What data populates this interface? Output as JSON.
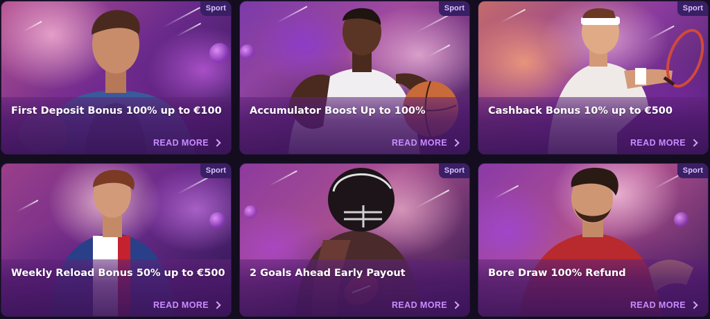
{
  "cards": [
    {
      "badge": "Sport",
      "title": "First Deposit Bonus 100% up to €100",
      "cta": "READ MORE",
      "icon": "chevron-right-icon"
    },
    {
      "badge": "Sport",
      "title": "Accumulator Boost Up to 100%",
      "cta": "READ MORE",
      "icon": "chevron-right-icon"
    },
    {
      "badge": "Sport",
      "title": "Cashback Bonus 10% up to €500",
      "cta": "READ MORE",
      "icon": "chevron-right-icon"
    },
    {
      "badge": "Sport",
      "title": "Weekly Reload Bonus 50% up to €500",
      "cta": "READ MORE",
      "icon": "chevron-right-icon"
    },
    {
      "badge": "Sport",
      "title": "2 Goals Ahead Early Payout",
      "cta": "READ MORE",
      "icon": "chevron-right-icon"
    },
    {
      "badge": "Sport",
      "title": "Bore Draw 100% Refund",
      "cta": "READ MORE",
      "icon": "chevron-right-icon"
    }
  ],
  "colors": {
    "page_background": "#130d1f",
    "badge_background": "#3a1f66",
    "badge_text": "#d9c4ff",
    "read_more": "#c98cff",
    "title_text": "#ffffff"
  }
}
